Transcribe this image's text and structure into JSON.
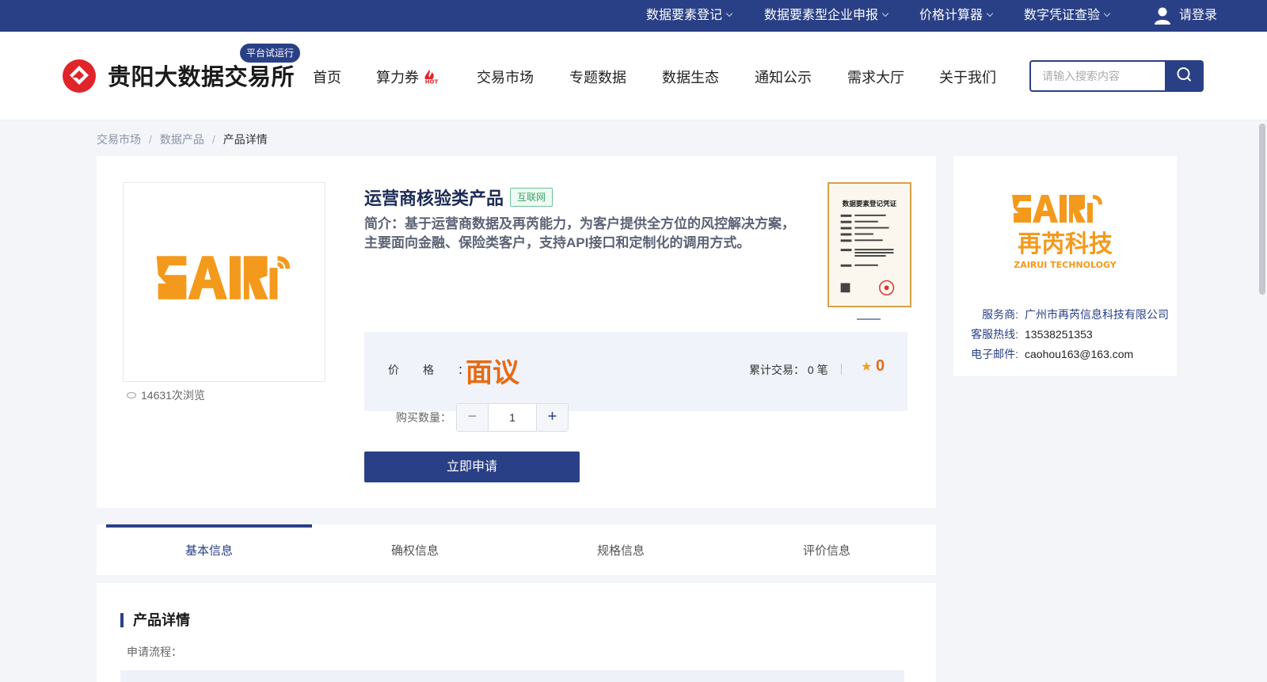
{
  "topbar": {
    "items": [
      "数据要素登记",
      "数据要素型企业申报",
      "价格计算器",
      "数字凭证查验"
    ],
    "login": "请登录"
  },
  "header": {
    "brand": "贵阳大数据交易所",
    "badge": "平台试运行",
    "nav": [
      "首页",
      "算力券",
      "交易市场",
      "专题数据",
      "数据生态",
      "通知公示",
      "需求大厅",
      "关于我们"
    ],
    "search_placeholder": "请输入搜索内容"
  },
  "breadcrumb": [
    "交易市场",
    "数据产品",
    "产品详情"
  ],
  "product": {
    "logo_text": "ZAIRUI",
    "views": "14631次浏览",
    "title": "运营商核验类产品",
    "tag": "互联网",
    "intro": "简介：基于运营商数据及再芮能力，为客户提供全方位的风控解决方案，主要面向金融、保险类客户，支持API接口和定制化的调用方式。",
    "cert_title": "数据要素登记凭证",
    "price_label": "价格：",
    "price": "面议",
    "trade": "累计交易：  0 笔",
    "rating": "0",
    "qty_label": "购买数量：",
    "qty": "1",
    "apply": "立即申请"
  },
  "provider": {
    "logo_cn": "再芮科技",
    "logo_en": "ZAIRUI TECHNOLOGY",
    "service_label": "服务商:",
    "service": "广州市再芮信息科技有限公司",
    "hotline_label": "客服热线:",
    "hotline": "13538251353",
    "email_label": "电子邮件:",
    "email": "caohou163@163.com"
  },
  "tabs": [
    "基本信息",
    "确权信息",
    "规格信息",
    "评价信息"
  ],
  "detail": {
    "title": "产品详情",
    "flow_label": "申请流程："
  },
  "colors": {
    "primary": "#2a4086",
    "accent": "#e56b16",
    "logo_orange": "#f39a1d",
    "brand_red": "#e0252a"
  }
}
